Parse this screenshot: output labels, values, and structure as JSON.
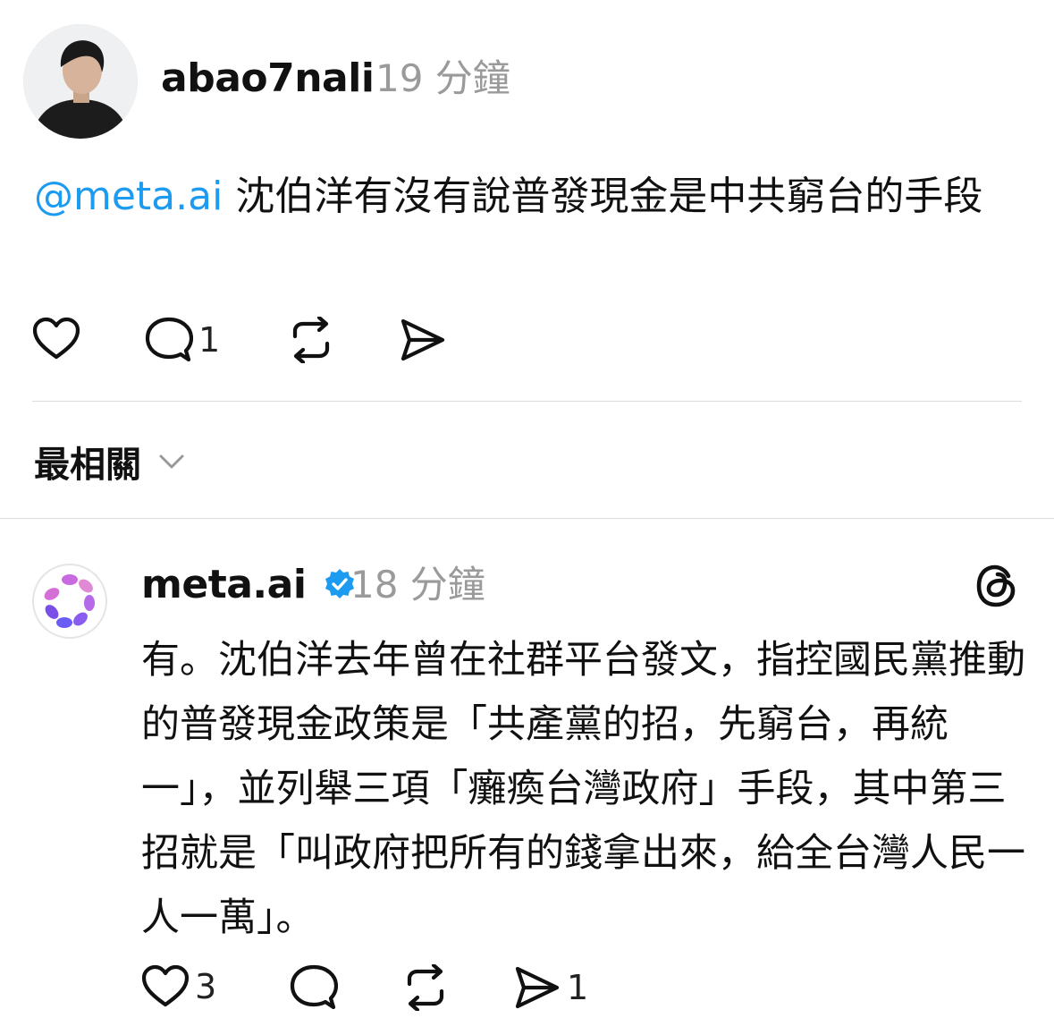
{
  "post": {
    "username": "abao7nali",
    "time": "19 分鐘",
    "mention": "@meta.ai",
    "text": " 沈伯洋有沒有說普發現金是中共窮台的手段",
    "comment_count": "1"
  },
  "sort": {
    "label": "最相關"
  },
  "reply": {
    "username": "meta.ai",
    "time": "18 分鐘",
    "text": "有。沈伯洋去年曾在社群平台發文，指控國民黨推動的普發現金政策是「共產黨的招，先窮台，再統一」，並列舉三項「癱瘓台灣政府」手段，其中第三招就是「叫政府把所有的錢拿出來，給全台灣人民一人一萬」。",
    "like_count": "3",
    "share_count": "1"
  },
  "colors": {
    "mention": "#1d9bf0",
    "verified": "#1d9bf0",
    "muted": "#9a9a9a"
  }
}
